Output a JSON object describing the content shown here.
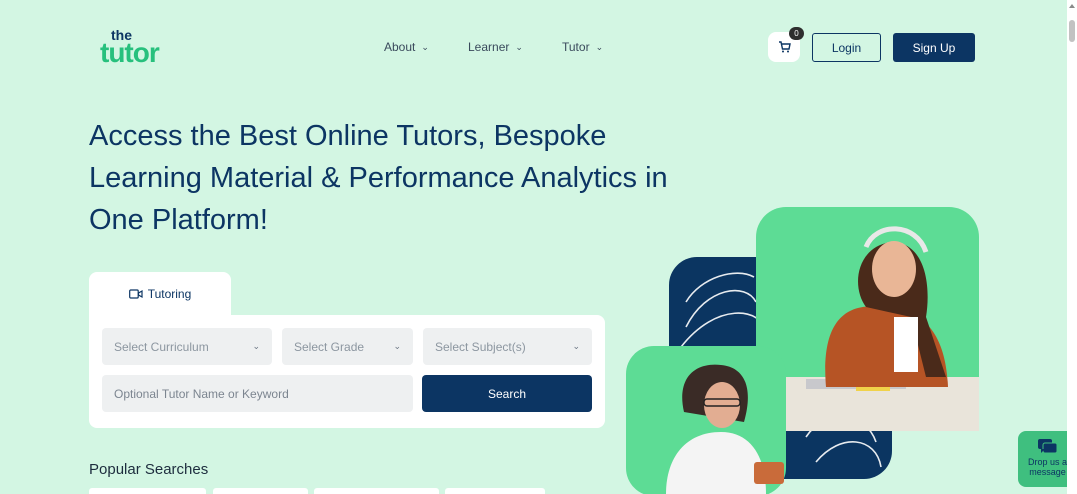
{
  "logo": {
    "the": "the",
    "tutor": "tutor"
  },
  "nav": [
    {
      "label": "About"
    },
    {
      "label": "Learner"
    },
    {
      "label": "Tutor"
    }
  ],
  "cart": {
    "count": "0"
  },
  "auth": {
    "login": "Login",
    "signup": "Sign Up"
  },
  "hero": {
    "line1": "Access the Best Online Tutors, Bespoke",
    "line2": "Learning Material & Performance Analytics in",
    "line3": "One Platform!"
  },
  "search": {
    "tab_label": "Tutoring",
    "curriculum_placeholder": "Select Curriculum",
    "grade_placeholder": "Select Grade",
    "subject_placeholder": "Select Subject(s)",
    "keyword_placeholder": "Optional Tutor Name or Keyword",
    "button": "Search"
  },
  "popular": {
    "title": "Popular Searches"
  },
  "chat_widget": {
    "line1": "Drop us a",
    "line2": "message"
  },
  "colors": {
    "background": "#d3f6e3",
    "primary": "#0c3563",
    "brand_green": "#27c07d",
    "accent_green": "#5ddc95"
  },
  "icons": [
    "cart-icon",
    "video-camera-icon",
    "chevron-down-icon",
    "chat-icon"
  ]
}
